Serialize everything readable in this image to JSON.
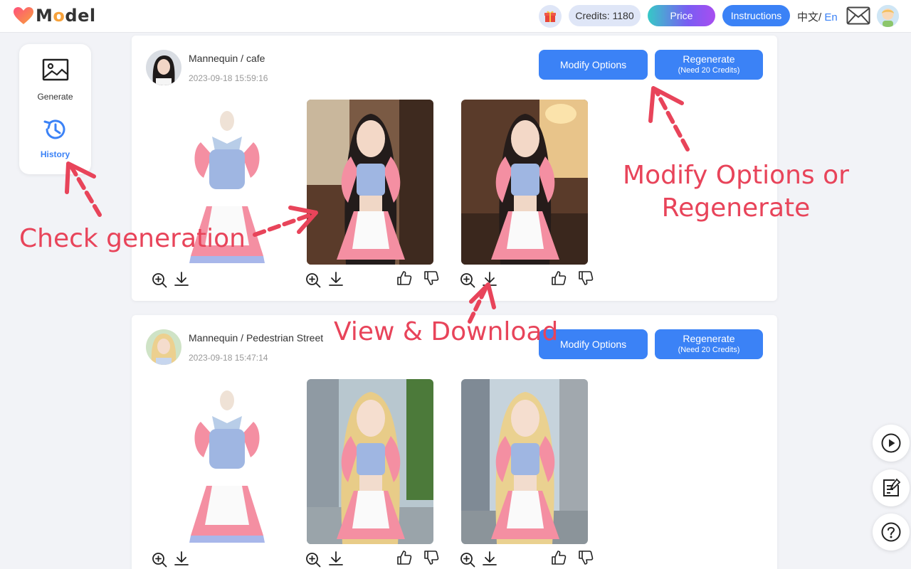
{
  "header": {
    "logo_text_prefix": "M",
    "logo_text_o": "o",
    "logo_text_suffix": "del",
    "credits_label": "Credits: 1180",
    "price_label": "Price",
    "instructions_label": "Instructions",
    "lang_zh": "中文",
    "lang_sep": "/ ",
    "lang_en": "En"
  },
  "sidebar": {
    "items": [
      {
        "label": "Generate",
        "icon": "image-icon"
      },
      {
        "label": "History",
        "icon": "history-icon"
      }
    ]
  },
  "records": [
    {
      "title": "Mannequin / cafe",
      "time": "2023-09-18 15:59:16",
      "modify_label": "Modify Options",
      "regenerate_label": "Regenerate",
      "regenerate_sub": "(Need 20 Credits)"
    },
    {
      "title": "Mannequin / Pedestrian Street",
      "time": "2023-09-18 15:47:14",
      "modify_label": "Modify Options",
      "regenerate_label": "Regenerate",
      "regenerate_sub": "(Need 20 Credits)"
    }
  ],
  "annotations": {
    "modify_line1": "Modify Options or",
    "modify_line2": "Regenerate",
    "check": "Check generation",
    "view": "View & Download"
  },
  "colors": {
    "accent": "#3b82f6",
    "annotation": "#e8445a",
    "logo_heart_start": "#ff4f7b",
    "logo_heart_end": "#f7a23b"
  }
}
